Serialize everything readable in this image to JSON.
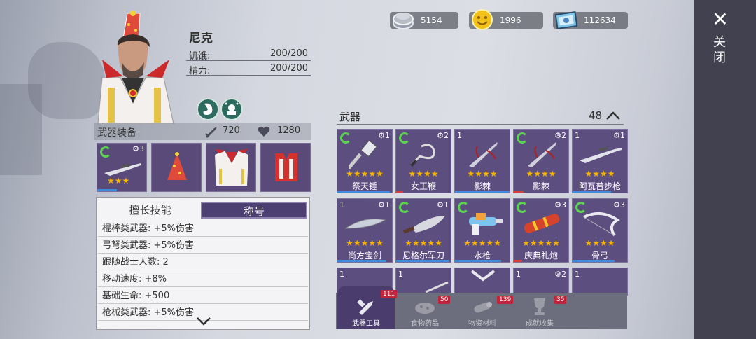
{
  "currency": {
    "coins_silver": "5154",
    "coins_gold": "1996",
    "tickets": "112634"
  },
  "close_label": "关闭",
  "character": {
    "name": "尼克",
    "hunger_label": "饥饿:",
    "hunger_value": "200/200",
    "energy_label": "精力:",
    "energy_value": "200/200"
  },
  "equipment": {
    "title": "武器装备",
    "attack": "720",
    "health": "1280",
    "weapon_slot_level": "3",
    "weapon_slot_stars": "★★★"
  },
  "skills": {
    "tab_skills": "擅长技能",
    "tab_title": "称号",
    "rows": [
      "棍棒类武器: +5%伤害",
      "弓弩类武器: +5%伤害",
      "跟随战士人数: 2",
      "移动速度: +8%",
      "基础生命: +500",
      "枪械类武器: +5%伤害"
    ]
  },
  "weapons": {
    "title": "武器",
    "count": "48",
    "items": [
      {
        "name": "祭天锤",
        "count": "",
        "level": "1",
        "stars": "★★★★★",
        "recycle": true,
        "dur_color": "#3d8bd9"
      },
      {
        "name": "女王鞭",
        "count": "",
        "level": "2",
        "stars": "★★★★",
        "recycle": true,
        "dur_color": "#d93d3d"
      },
      {
        "name": "影棘",
        "count": "1",
        "level": "",
        "stars": "★★★★",
        "recycle": false,
        "dur_color": "#3d8bd9"
      },
      {
        "name": "影棘",
        "count": "",
        "level": "2",
        "stars": "★★★★",
        "recycle": true,
        "dur_color": "#d93d3d"
      },
      {
        "name": "阿瓦普步枪",
        "count": "1",
        "level": "1",
        "stars": "★★★★",
        "recycle": false,
        "dur_color": "#3d8bd9"
      },
      {
        "name": "尚方宝剑",
        "count": "1",
        "level": "1",
        "stars": "★★★★★",
        "recycle": false,
        "dur_color": "#3d8bd9"
      },
      {
        "name": "尼格尔军刀",
        "count": "",
        "level": "1",
        "stars": "★★★★★",
        "recycle": true,
        "dur_color": "#3d8bd9"
      },
      {
        "name": "水枪",
        "count": "",
        "level": "",
        "stars": "★★★★★",
        "recycle": true,
        "dur_color": "#3d8bd9"
      },
      {
        "name": "庆典礼炮",
        "count": "",
        "level": "3",
        "stars": "★★★★★",
        "recycle": true,
        "dur_color": "#d93d3d"
      },
      {
        "name": "骨弓",
        "count": "",
        "level": "3",
        "stars": "★★★★",
        "recycle": true,
        "dur_color": "#3d8bd9"
      },
      {
        "name": "",
        "count": "1",
        "level": "",
        "stars": "",
        "recycle": false,
        "dur_color": ""
      },
      {
        "name": "",
        "count": "1",
        "level": "",
        "stars": "",
        "recycle": false,
        "dur_color": ""
      },
      {
        "name": "",
        "count": "",
        "level": "",
        "stars": "",
        "recycle": false,
        "dur_color": ""
      },
      {
        "name": "",
        "count": "1",
        "level": "2",
        "stars": "",
        "recycle": false,
        "dur_color": ""
      },
      {
        "name": "",
        "count": "1",
        "level": "",
        "stars": "",
        "recycle": false,
        "dur_color": ""
      }
    ]
  },
  "bottom_tabs": [
    {
      "label": "武器工具",
      "badge": "111"
    },
    {
      "label": "食物药品",
      "badge": "50"
    },
    {
      "label": "物资材料",
      "badge": "139"
    },
    {
      "label": "成就收集",
      "badge": "35"
    }
  ],
  "colors": {
    "card_bg": "#5d4e80",
    "star": "#f7b500",
    "badge": "#c0243a",
    "sidebar": "#41414f"
  }
}
